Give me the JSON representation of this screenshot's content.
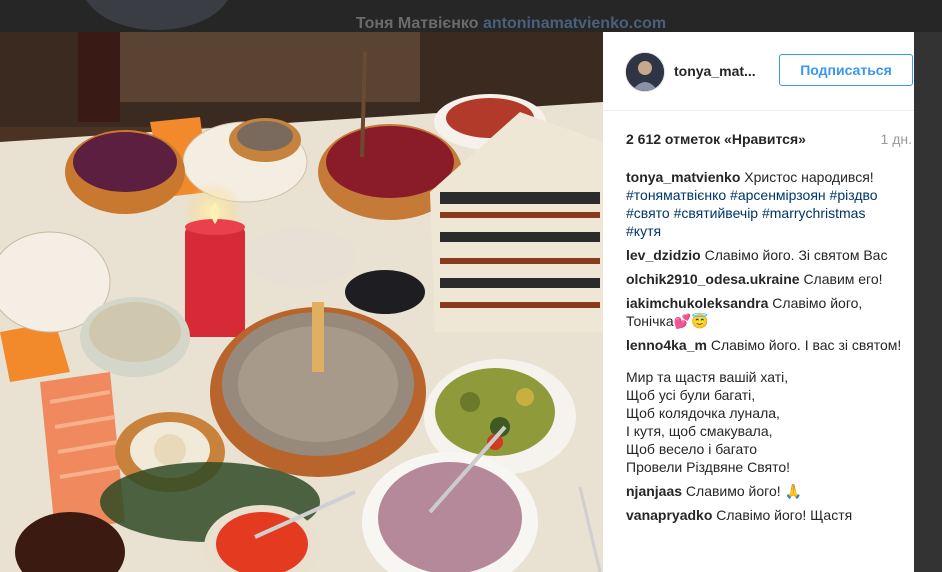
{
  "background_header": {
    "name": "Тоня Матвієнко",
    "link": "antoninamatvienko.com"
  },
  "post": {
    "username": "tonya_mat...",
    "follow_label": "Подписаться",
    "likes": "2 612 отметок «Нравится»",
    "time": "1 дн.",
    "caption": {
      "user": "tonya_matvienko",
      "text": "Христос народився!",
      "tags": [
        "#тоняматвієнко",
        "#арсенмірзоян",
        "#різдво",
        "#свято",
        "#святийвечір",
        "#marrychristmas",
        "#кутя"
      ]
    },
    "comments": [
      {
        "user": "lev_dzidzio",
        "text": "Славімо його. Зі святом Вас"
      },
      {
        "user": "olchik2910_odesa.ukraine",
        "text": "Славим его!"
      },
      {
        "user": "iakimchukoleksandra",
        "text": "Славімо його, Тонічка💕😇"
      },
      {
        "user": "lenno4ka_m",
        "text": "Славімо його. І вас зі святом!"
      }
    ],
    "poem": [
      "Мир та щастя вашій хаті,",
      "Щоб усі були багаті,",
      "Щоб колядочка лунала,",
      "І кутя, щоб смакувала,",
      "Щоб весело і багато",
      "Провели Різдвяне Свято!"
    ],
    "comments_after": [
      {
        "user": "njanjaas",
        "text": "Славимо його! 🙏"
      },
      {
        "user": "vanapryadko",
        "text": "Славімо його! Щастя"
      }
    ]
  },
  "colors": {
    "accent": "#3897f0",
    "hashtag": "#003569",
    "text": "#262626",
    "muted": "#999999"
  }
}
